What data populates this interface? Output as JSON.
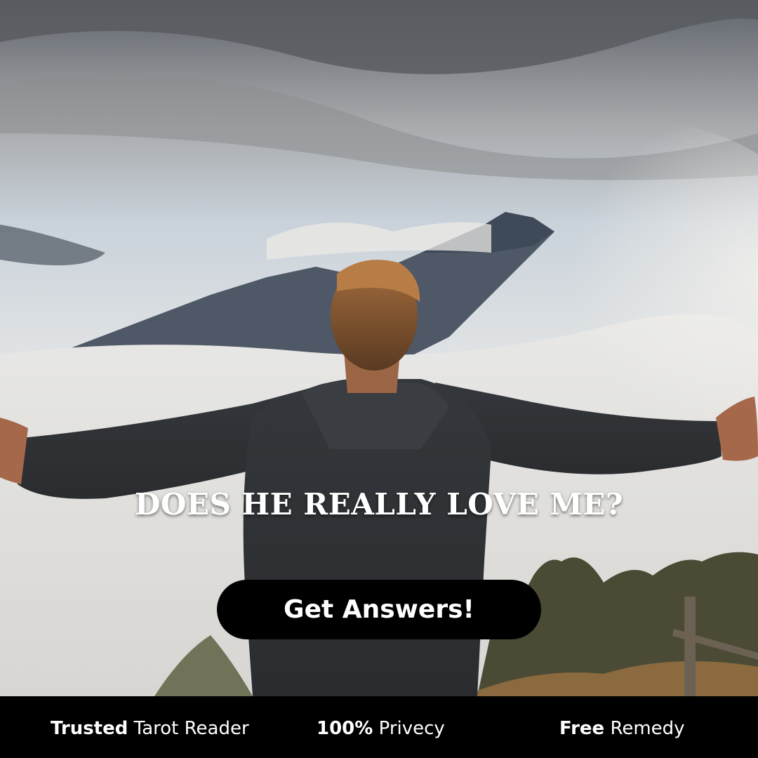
{
  "headline": "DOES HE REALLY LOVE ME?",
  "cta": {
    "label": "Get Answers!"
  },
  "footer": {
    "features": [
      {
        "strong": "Trusted",
        "text": " Tarot Reader"
      },
      {
        "strong": "100%",
        "text": " Privecy"
      },
      {
        "strong": "Free",
        "text": " Remedy"
      }
    ]
  },
  "colors": {
    "button_bg": "#000000",
    "footer_bg": "#000000",
    "text": "#ffffff"
  }
}
